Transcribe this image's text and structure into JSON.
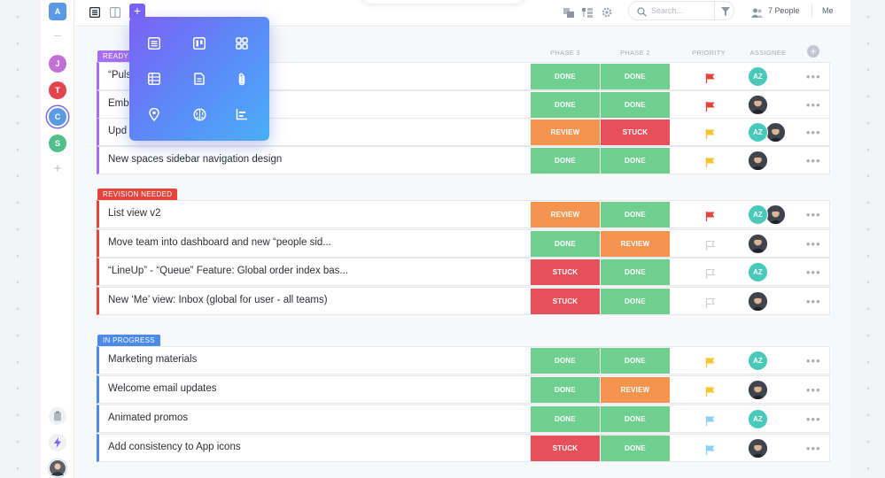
{
  "sidebar": {
    "workspace_initial": "A",
    "avatars": [
      {
        "initial": "J",
        "color": "#c270d6"
      },
      {
        "initial": "T",
        "color": "#e3454e"
      },
      {
        "initial": "C",
        "color": "#5b9be6"
      },
      {
        "initial": "S",
        "color": "#52c08c"
      }
    ]
  },
  "topbar": {
    "search_placeholder": "Search...",
    "people_label": "7 People",
    "me_label": "Me"
  },
  "columns": {
    "phase3": "PHASE 3",
    "phase2": "PHASE 2",
    "priority": "PRIORITY",
    "assignee": "ASSIGNEE"
  },
  "colors": {
    "done": "#6fcf8f",
    "review": "#f5944f",
    "stuck": "#e5505a",
    "ready": "#a56ff0",
    "revision": "#e5443c",
    "progress": "#4b8ae8",
    "flag_red": "#e5443c",
    "flag_yellow": "#f7c531",
    "flag_blue": "#8fd0f5",
    "flag_gray": "#cdd0d6"
  },
  "groups": [
    {
      "label": "READY",
      "tasks": [
        {
          "name": "“Puls",
          "phase3": "DONE",
          "phase2": "DONE",
          "priority": "red",
          "assignees": [
            "AZ"
          ]
        },
        {
          "name": "Emb",
          "phase3": "DONE",
          "phase2": "DONE",
          "priority": "red",
          "assignees": [
            "face"
          ]
        },
        {
          "name": "Upd",
          "phase3": "REVIEW",
          "phase2": "STUCK",
          "priority": "yellow",
          "assignees": [
            "AZ",
            "face"
          ]
        },
        {
          "name": "New spaces sidebar navigation design",
          "phase3": "DONE",
          "phase2": "DONE",
          "priority": "yellow",
          "assignees": [
            "face"
          ]
        }
      ]
    },
    {
      "label": "REVISION NEEDED",
      "tasks": [
        {
          "name": "List view v2",
          "phase3": "REVIEW",
          "phase2": "DONE",
          "priority": "red",
          "assignees": [
            "AZ",
            "face"
          ]
        },
        {
          "name": "Move team into dashboard and new “people sid...",
          "phase3": "DONE",
          "phase2": "REVIEW",
          "priority": "gray",
          "assignees": [
            "face"
          ]
        },
        {
          "name": "“LineUp” - “Queue” Feature: Global order index bas...",
          "phase3": "STUCK",
          "phase2": "DONE",
          "priority": "gray",
          "assignees": [
            "AZ"
          ]
        },
        {
          "name": "New ‘Me’ view: Inbox (global for user - all teams)",
          "phase3": "STUCK",
          "phase2": "DONE",
          "priority": "gray",
          "assignees": [
            "face"
          ]
        }
      ]
    },
    {
      "label": "IN PROGRESS",
      "tasks": [
        {
          "name": "Marketing  materials",
          "phase3": "DONE",
          "phase2": "DONE",
          "priority": "yellow",
          "assignees": [
            "AZ"
          ]
        },
        {
          "name": "Welcome email updates",
          "phase3": "DONE",
          "phase2": "REVIEW",
          "priority": "yellow",
          "assignees": [
            "face"
          ]
        },
        {
          "name": "Animated promos",
          "phase3": "DONE",
          "phase2": "DONE",
          "priority": "blue",
          "assignees": [
            "AZ"
          ]
        },
        {
          "name": "Add consistency to App icons",
          "phase3": "STUCK",
          "phase2": "DONE",
          "priority": "blue",
          "assignees": [
            "face"
          ]
        }
      ]
    }
  ],
  "popup": {
    "icons": [
      "list-view-icon",
      "board-view-icon",
      "box-view-icon",
      "table-view-icon",
      "doc-view-icon",
      "attachment-icon",
      "map-icon",
      "mind-map-icon",
      "chart-icon"
    ]
  }
}
